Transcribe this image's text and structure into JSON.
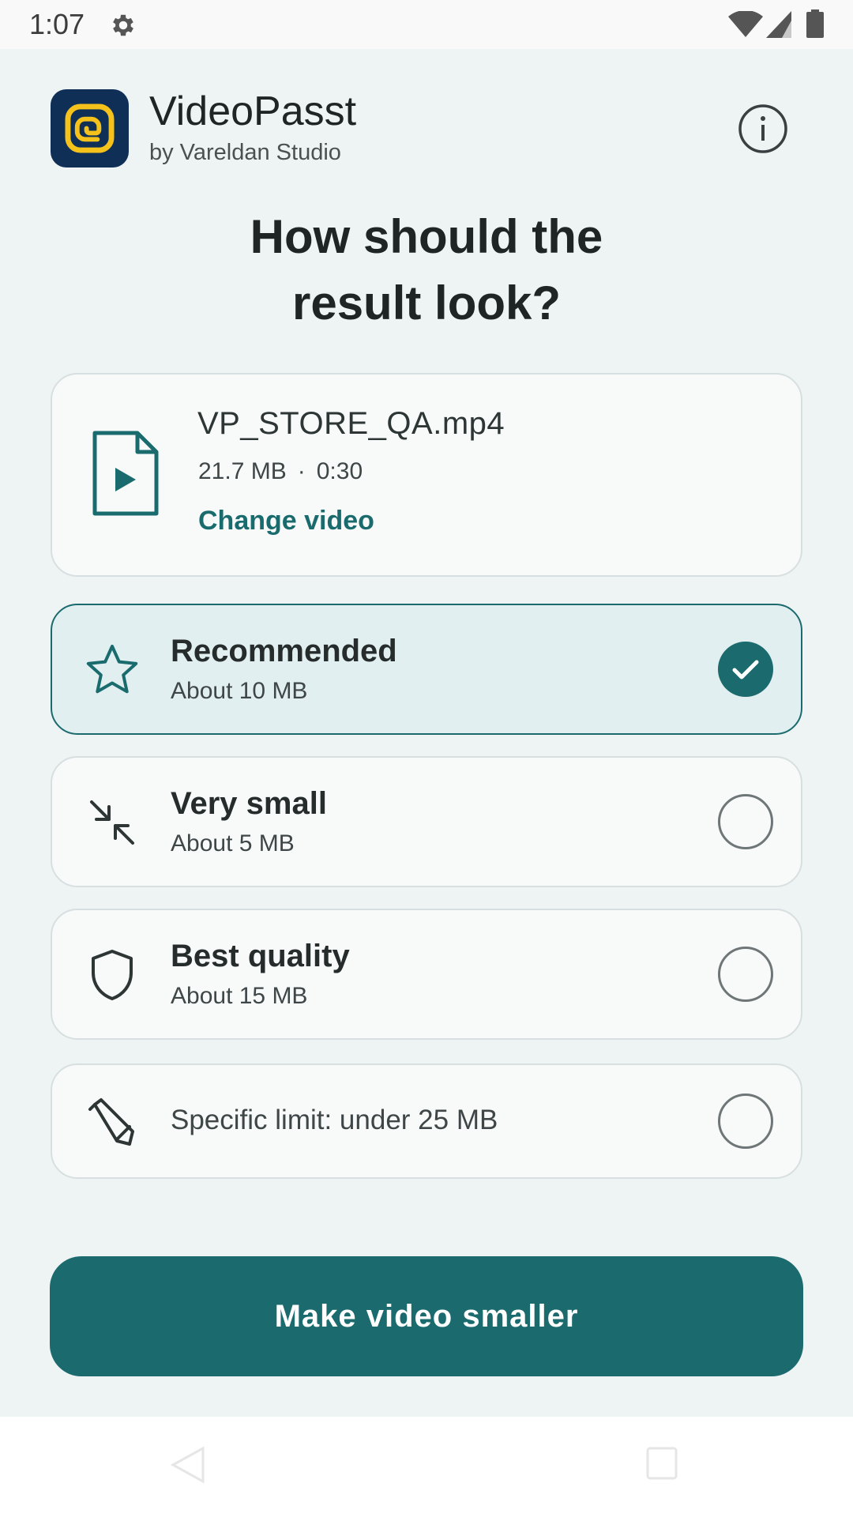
{
  "status_bar": {
    "time": "1:07",
    "icons": [
      "gear-icon",
      "wifi-icon",
      "cell-signal-icon",
      "battery-icon"
    ]
  },
  "header": {
    "app_name": "VideoPasst",
    "publisher": "by Vareldan Studio",
    "logo_icon": "app-logo-icon",
    "info_icon": "info-icon"
  },
  "headline": {
    "line1": "How should the",
    "line2": "result look?"
  },
  "file": {
    "name": "VP_STORE_QA.mp4",
    "size": "21.7 MB",
    "separator": "·",
    "duration": "0:30",
    "change_label": "Change video",
    "icon": "video-file-icon"
  },
  "options": [
    {
      "title": "Recommended",
      "subtitle": "About 10 MB",
      "icon": "star-icon",
      "selected": true
    },
    {
      "title": "Very small",
      "subtitle": "About 5 MB",
      "icon": "compress-arrows-icon",
      "selected": false
    },
    {
      "title": "Best quality",
      "subtitle": "About 15 MB",
      "icon": "shield-icon",
      "selected": false
    },
    {
      "label": "Specific limit: under 25 MB",
      "icon": "pencil-icon",
      "selected": false
    }
  ],
  "primary_action": {
    "label": "Make video smaller"
  },
  "colors": {
    "accent": "#1b6a6e",
    "background": "#eef3f4",
    "selected_card": "#e1eff0",
    "logo_bg": "#0f2f57",
    "logo_fg": "#f4c21a"
  }
}
